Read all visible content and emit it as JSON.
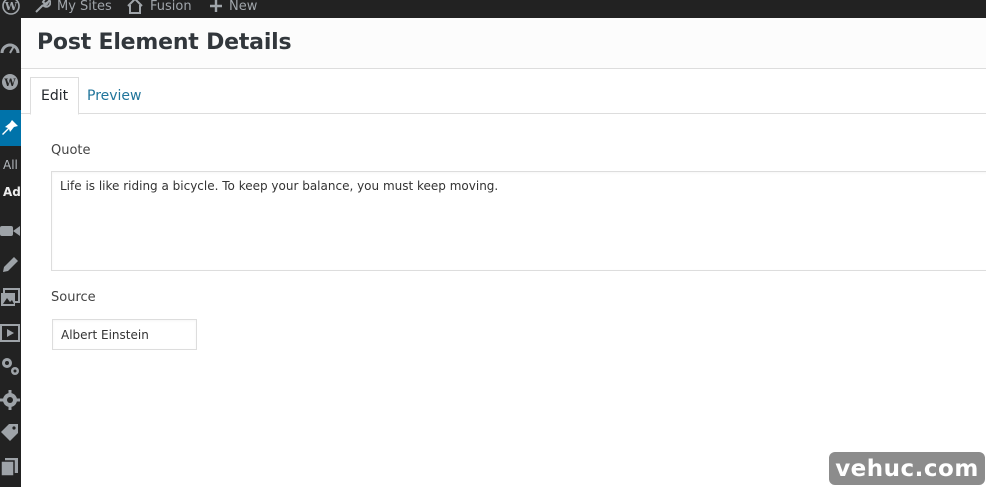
{
  "admin_bar": {
    "my_sites_label": "My Sites",
    "site_label": "Fusion",
    "new_label": "New"
  },
  "side_menu": {
    "all_label": "All",
    "add_label": "Ad"
  },
  "modal": {
    "title": "Post Element Details",
    "tabs": [
      {
        "label": "Edit",
        "active": true
      },
      {
        "label": "Preview",
        "active": false
      }
    ],
    "fields": {
      "quote": {
        "label": "Quote",
        "value": "Life is like riding a bicycle. To keep your balance, you must keep moving."
      },
      "source": {
        "label": "Source",
        "value": "Albert Einstein"
      }
    }
  },
  "watermark": "vehuc.com",
  "colors": {
    "admin_bar_bg": "#222222",
    "accent_blue": "#0073aa",
    "link_blue": "#21759b",
    "border": "#dddddd"
  }
}
